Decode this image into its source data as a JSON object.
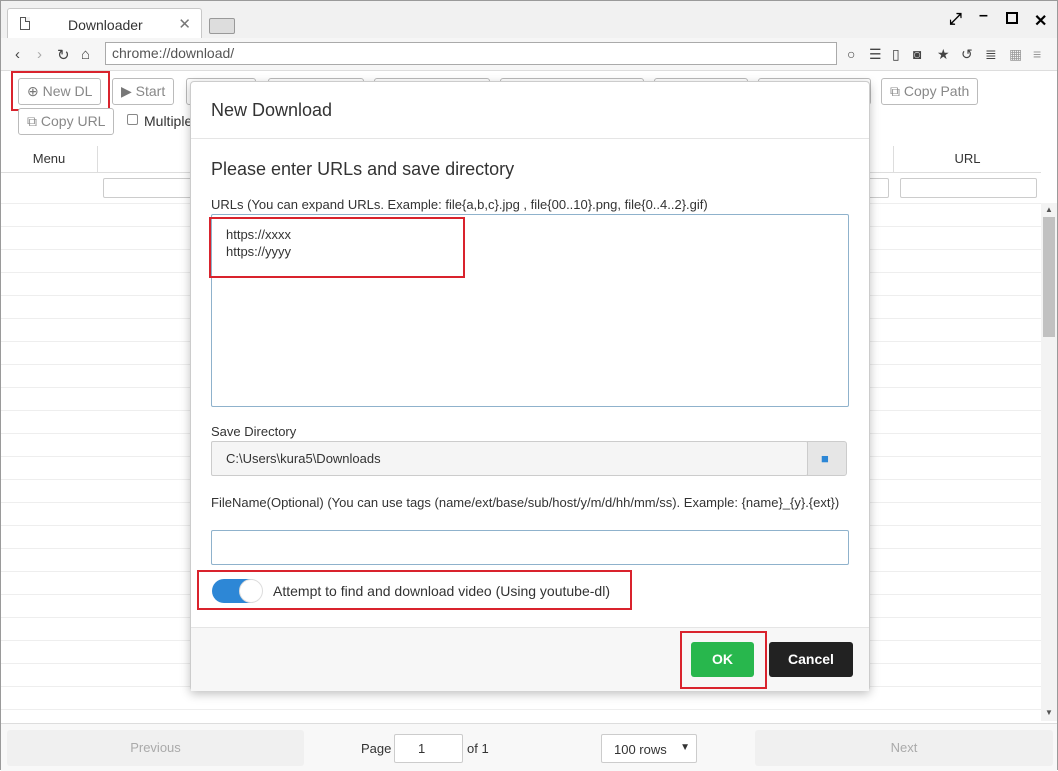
{
  "browser": {
    "tab_title": "Downloader",
    "tab_close": "✕",
    "address": "chrome://download/"
  },
  "toolbar": {
    "new_dl": "New DL",
    "start": "Start",
    "copy_path": "Copy Path",
    "copy_url": "Copy URL",
    "multiple": "Multiple"
  },
  "grid": {
    "col_menu": "Menu",
    "col_url": "URL"
  },
  "footer": {
    "previous": "Previous",
    "page_label": "Page",
    "page_value": "1",
    "of_label": "of 1",
    "rows": "100 rows",
    "next": "Next"
  },
  "modal": {
    "title": "New Download",
    "heading": "Please enter URLs and save directory",
    "urls_label": "URLs (You can expand URLs. Example: file{a,b,c}.jpg , file{00..10}.png, file{0..4..2}.gif)",
    "urls_value": "https://xxxx\nhttps://yyyy",
    "save_dir_label": "Save Directory",
    "save_dir_value": "C:\\Users\\kura5\\Downloads",
    "filename_label": "FileName(Optional) (You can use tags (name/ext/base/sub/host/y/m/d/hh/mm/ss). Example: {name}_{y}.{ext})",
    "filename_value": "",
    "video_toggle_label": "Attempt to find and download video (Using youtube-dl)",
    "ok": "OK",
    "cancel": "Cancel"
  },
  "colors": {
    "highlight": "#d9232d",
    "ok": "#28b74d",
    "toggle": "#2d87d6"
  }
}
